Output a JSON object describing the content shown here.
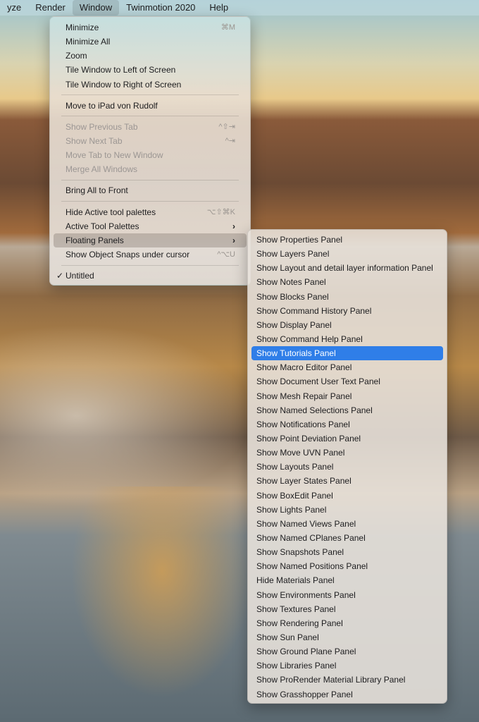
{
  "menubar": {
    "items": [
      "yze",
      "Render",
      "Window",
      "Twinmotion 2020",
      "Help"
    ],
    "active": "Window"
  },
  "window_menu": {
    "groups": [
      [
        {
          "label": "Minimize",
          "shortcut": "⌘M"
        },
        {
          "label": "Minimize All"
        },
        {
          "label": "Zoom"
        },
        {
          "label": "Tile Window to Left of Screen"
        },
        {
          "label": "Tile Window to Right of Screen"
        }
      ],
      [
        {
          "label": "Move to iPad von Rudolf"
        }
      ],
      [
        {
          "label": "Show Previous Tab",
          "shortcut": "^⇧⇥",
          "disabled": true
        },
        {
          "label": "Show Next Tab",
          "shortcut": "^⇥",
          "disabled": true
        },
        {
          "label": "Move Tab to New Window",
          "disabled": true
        },
        {
          "label": "Merge All Windows",
          "disabled": true
        }
      ],
      [
        {
          "label": "Bring All to Front"
        }
      ],
      [
        {
          "label": "Hide Active tool palettes",
          "shortcut": "⌥⇧⌘K"
        },
        {
          "label": "Active Tool Palettes",
          "submenu": true
        },
        {
          "label": "Floating Panels",
          "submenu": true,
          "open": true
        },
        {
          "label": "Show Object Snaps under cursor",
          "shortcut": "^⌥U"
        }
      ],
      [
        {
          "label": "Untitled",
          "checked": true
        }
      ]
    ]
  },
  "floating_panels_menu": {
    "highlighted": "Show Tutorials Panel",
    "items": [
      "Show Properties Panel",
      "Show Layers Panel",
      "Show Layout and detail layer information Panel",
      "Show Notes Panel",
      "Show Blocks Panel",
      "Show Command History Panel",
      "Show Display Panel",
      "Show Command Help Panel",
      "Show Tutorials Panel",
      "Show Macro Editor Panel",
      "Show Document User Text Panel",
      "Show Mesh Repair Panel",
      "Show Named Selections Panel",
      "Show Notifications Panel",
      "Show Point Deviation Panel",
      "Show Move UVN Panel",
      "Show Layouts Panel",
      "Show Layer States Panel",
      "Show BoxEdit Panel",
      "Show Lights Panel",
      "Show Named Views Panel",
      "Show Named CPlanes Panel",
      "Show Snapshots Panel",
      "Show Named Positions Panel",
      "Hide Materials Panel",
      "Show Environments Panel",
      "Show Textures Panel",
      "Show Rendering Panel",
      "Show Sun Panel",
      "Show Ground Plane Panel",
      "Show Libraries Panel",
      "Show ProRender Material Library Panel",
      "Show Grasshopper Panel"
    ]
  },
  "icons": {
    "chevron": "›",
    "check": "✓"
  }
}
